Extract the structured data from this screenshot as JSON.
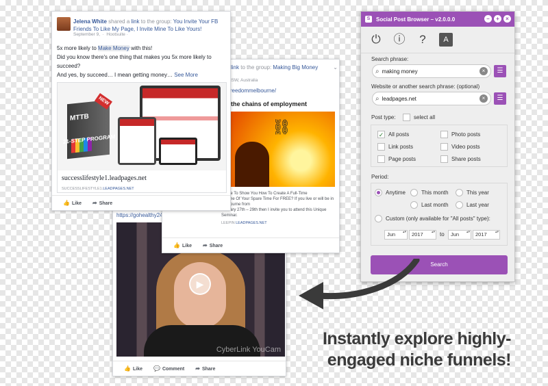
{
  "post1": {
    "author": "Jelena White",
    "action_pre": "shared a",
    "action_link": "link",
    "action_post": "to the group:",
    "group": "You Invite Your FB Friends To Like My Page, I Invite Mine To Like Yours!",
    "date": "September 9,",
    "visibility": "Hootsuite",
    "line1_pre": "5x more likely to",
    "line1_link": "Make Money",
    "line1_post": "with this!",
    "line2": "Did you know there's one thing that makes you 5x more likely to succeed?",
    "line3_pre": "And yes, by succeed… I mean getting money…",
    "see_more": "See More",
    "product_label": "MTTB",
    "product_new": "NEW",
    "product_sub": "21-STEP PROGRAM",
    "link_title": "successlifestyle1.leadpages.net",
    "link_domain_pre": "SUCCESSLIFESTYLE1.",
    "link_domain_link": "LEADPAGES.NET",
    "like": "Like",
    "share": "Share"
  },
  "post2": {
    "action_link": "link",
    "action_post": "to the group:",
    "group": "Making Big Money",
    "location": "ey, NSW, Australia",
    "url": "/imfreedommelbourne/",
    "image_text": "the chains of employment",
    "desc_line1": "onaire To Show You How To Create A Full-Time",
    "desc_line2": "Income Of Your Spare Time For FREE? If you live or will be in Melbourne from",
    "desc_line3": "January 27th – 29th then I invite you to attend this Unique Seminar.",
    "domain_pre": "LEEPIN",
    "domain_link": "LEADPAGES.NET",
    "like": "Like",
    "share": "Share"
  },
  "post3": {
    "url": "https://gohealthy247",
    "watermark": "CyberLink YouCam",
    "like": "Like",
    "comment": "Comment",
    "share": "Share"
  },
  "panel": {
    "title": "Social Post Browser – v2.0.0.0",
    "search_phrase_label": "Search phrase:",
    "search_phrase_value": "making money",
    "website_label": "Website or another search phrase: (optional)",
    "website_value": "leadpages.net",
    "post_type_label": "Post type:",
    "select_all": "select all",
    "types": [
      "All posts",
      "Photo posts",
      "Link posts",
      "Video posts",
      "Page posts",
      "Share posts"
    ],
    "period_label": "Period:",
    "periods": [
      "Anytime",
      "This month",
      "This year",
      "Last month",
      "Last year"
    ],
    "custom": "Custom (only available for \"All posts\" type):",
    "from_month": "Jun",
    "from_year": "2017",
    "to": "to",
    "to_month": "Jun",
    "to_year": "2017",
    "search_button": "Search"
  },
  "headline": {
    "line1": "Instantly explore highly-",
    "line2": "engaged niche funnels!"
  },
  "colors": {
    "accent": "#9b51b6",
    "fb_link": "#365899"
  }
}
